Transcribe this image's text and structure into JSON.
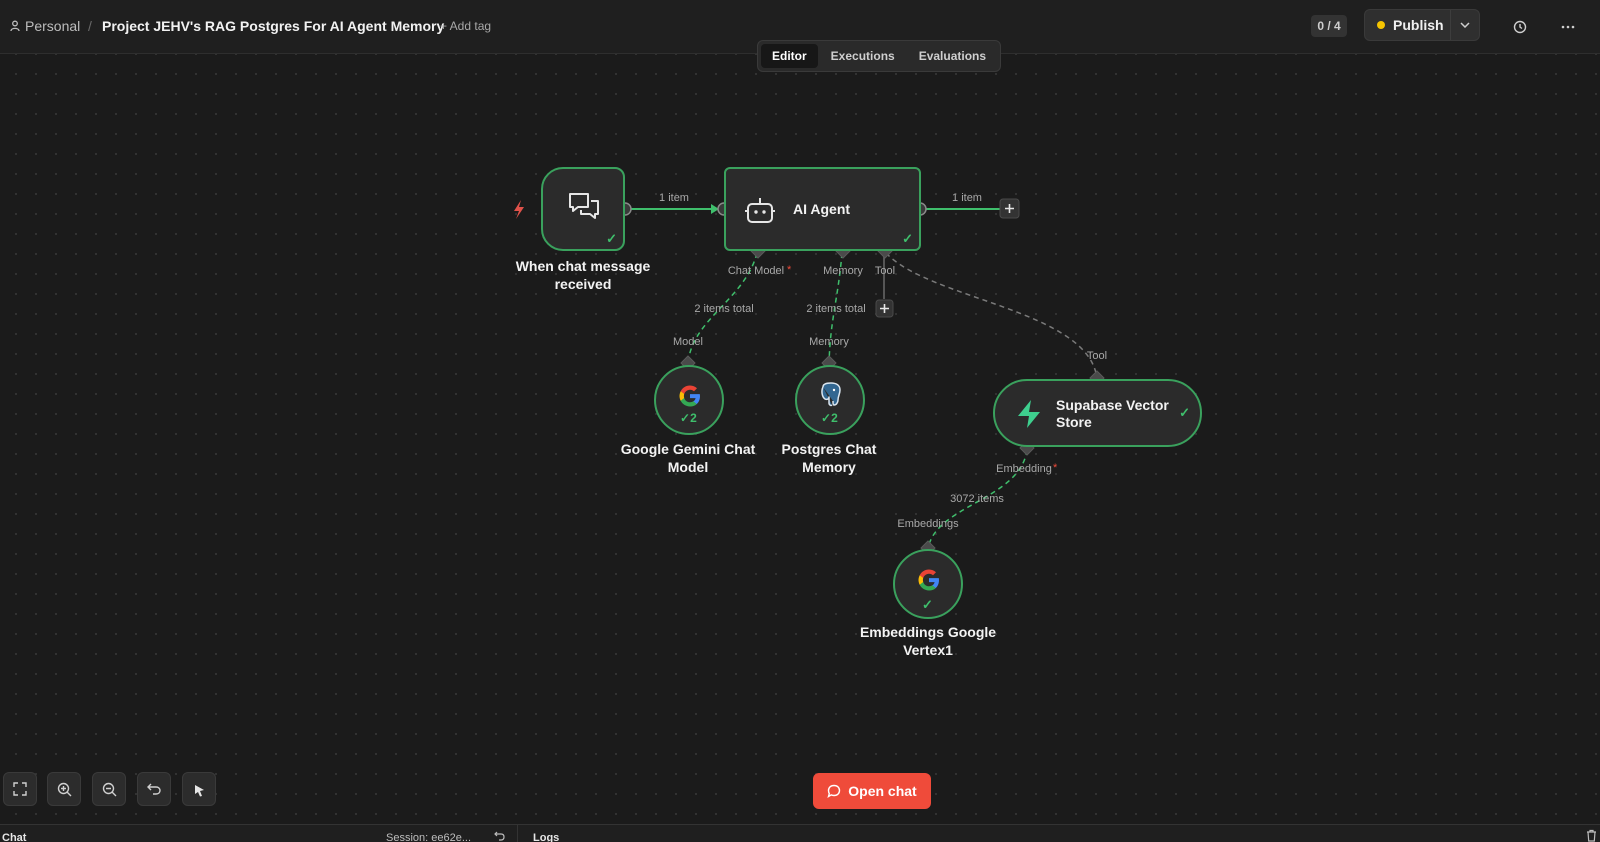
{
  "header": {
    "personal": "Personal",
    "separator": "/",
    "title": "Project JEHV's RAG Postgres For AI Agent Memory",
    "add_tag": "+ Add tag",
    "counter": "0 / 4",
    "publish": "Publish"
  },
  "tabs": [
    "Editor",
    "Executions",
    "Evaluations"
  ],
  "nodes": {
    "trigger": {
      "label_line1": "When chat message",
      "label_line2": "received"
    },
    "agent": {
      "label": "AI Agent"
    },
    "gemini": {
      "label_line1": "Google Gemini Chat",
      "label_line2": "Model",
      "count": "2"
    },
    "postgres": {
      "label_line1": "Postgres Chat",
      "label_line2": "Memory",
      "count": "2"
    },
    "supabase": {
      "label_line1": "Supabase Vector",
      "label_line2": "Store"
    },
    "embeddings": {
      "label_line1": "Embeddings Google",
      "label_line2": "Vertex1"
    }
  },
  "edges": {
    "trigger_agent": "1 item",
    "agent_out": "1 item",
    "model_total": "2 items total",
    "memory_total": "2 items total",
    "embed_total": "3072 items"
  },
  "ports": {
    "chat_model": "Chat Model",
    "memory": "Memory",
    "tool": "Tool",
    "model_in": "Model",
    "memory_in": "Memory",
    "tool_in": "Tool",
    "embedding": "Embedding",
    "embeddings_in": "Embeddings",
    "required_mark": "*"
  },
  "open_chat": "Open chat",
  "bottom": {
    "chat": "Chat",
    "session": "Session: ee62e...",
    "logs": "Logs"
  },
  "colors": {
    "accent_green": "#3aa15d",
    "publish_dot": "#f5c400",
    "open_chat": "#ef4b3a",
    "trigger_bolt": "#e0524a"
  }
}
